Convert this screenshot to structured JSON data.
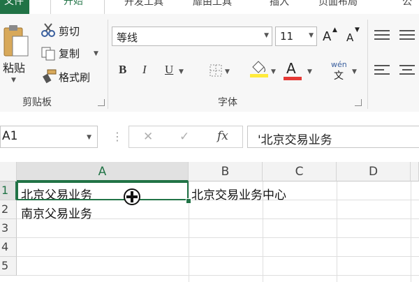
{
  "ribbon_tabs": {
    "file": "文件",
    "home": "开始",
    "tab3": "开发工具",
    "tab4": "靡由工具",
    "tab5": "插入",
    "tab6": "页面布局",
    "tab7": "公"
  },
  "clipboard": {
    "paste_label": "粘贴",
    "cut_label": "剪切",
    "copy_label": "复制",
    "format_painter_label": "格式刷",
    "group_label": "剪贴板"
  },
  "font": {
    "name": "等线",
    "size": "11",
    "group_label": "字体",
    "grow_label": "A",
    "shrink_label": "A",
    "bold_label": "B",
    "italic_label": "I",
    "underline_label": "U",
    "font_color_label": "A",
    "phonetic_label": "wén",
    "phonetic_char": "文",
    "highlight_color": "#ffeb3b",
    "font_color": "#e53935"
  },
  "formula_bar": {
    "name_box": "A1",
    "cancel_symbol": "✕",
    "enter_symbol": "✓",
    "fx_label": "fx",
    "formula": "'北京交易业务"
  },
  "sheet": {
    "columns": [
      "A",
      "B",
      "C",
      "D"
    ],
    "rows": [
      "1",
      "2",
      "3",
      "4",
      "5"
    ],
    "cells": {
      "A1": "北京父易业务",
      "B1": "北京交易业务中心",
      "A2": "南京父易业务"
    },
    "selected_cell": "A1",
    "accent": "#217346"
  }
}
